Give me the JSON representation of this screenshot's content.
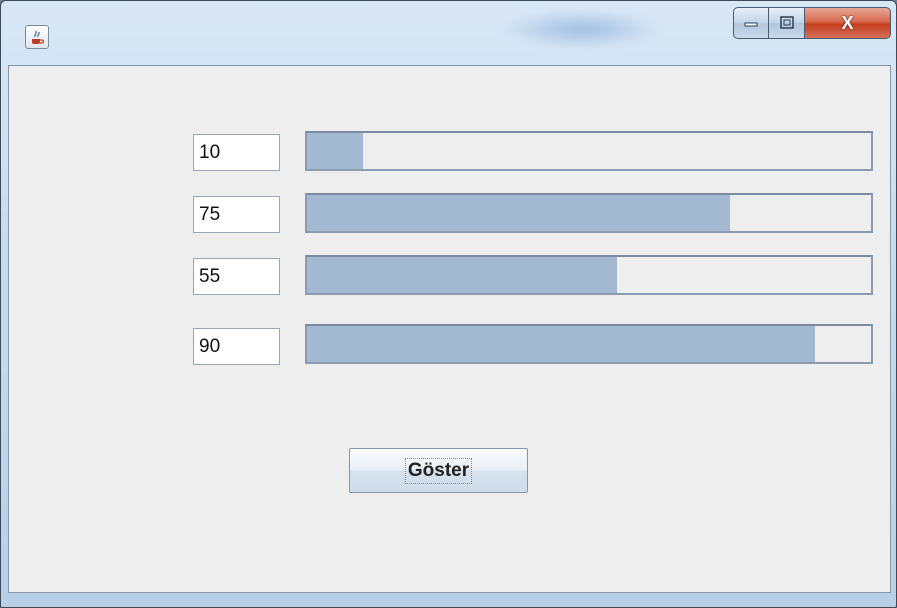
{
  "window": {
    "icon": "java-cup-icon",
    "controls": [
      "minimize-icon",
      "maximize-icon",
      "close-icon"
    ],
    "close_glyph": "X"
  },
  "rows": [
    {
      "field_value": "10",
      "progress_percent": 10
    },
    {
      "field_value": "75",
      "progress_percent": 75
    },
    {
      "field_value": "55",
      "progress_percent": 55
    },
    {
      "field_value": "90",
      "progress_percent": 90
    }
  ],
  "show_button": {
    "label": "Göster"
  },
  "colors": {
    "progress_fill": "#a3b8d1",
    "panel_background": "#eeeeee"
  }
}
